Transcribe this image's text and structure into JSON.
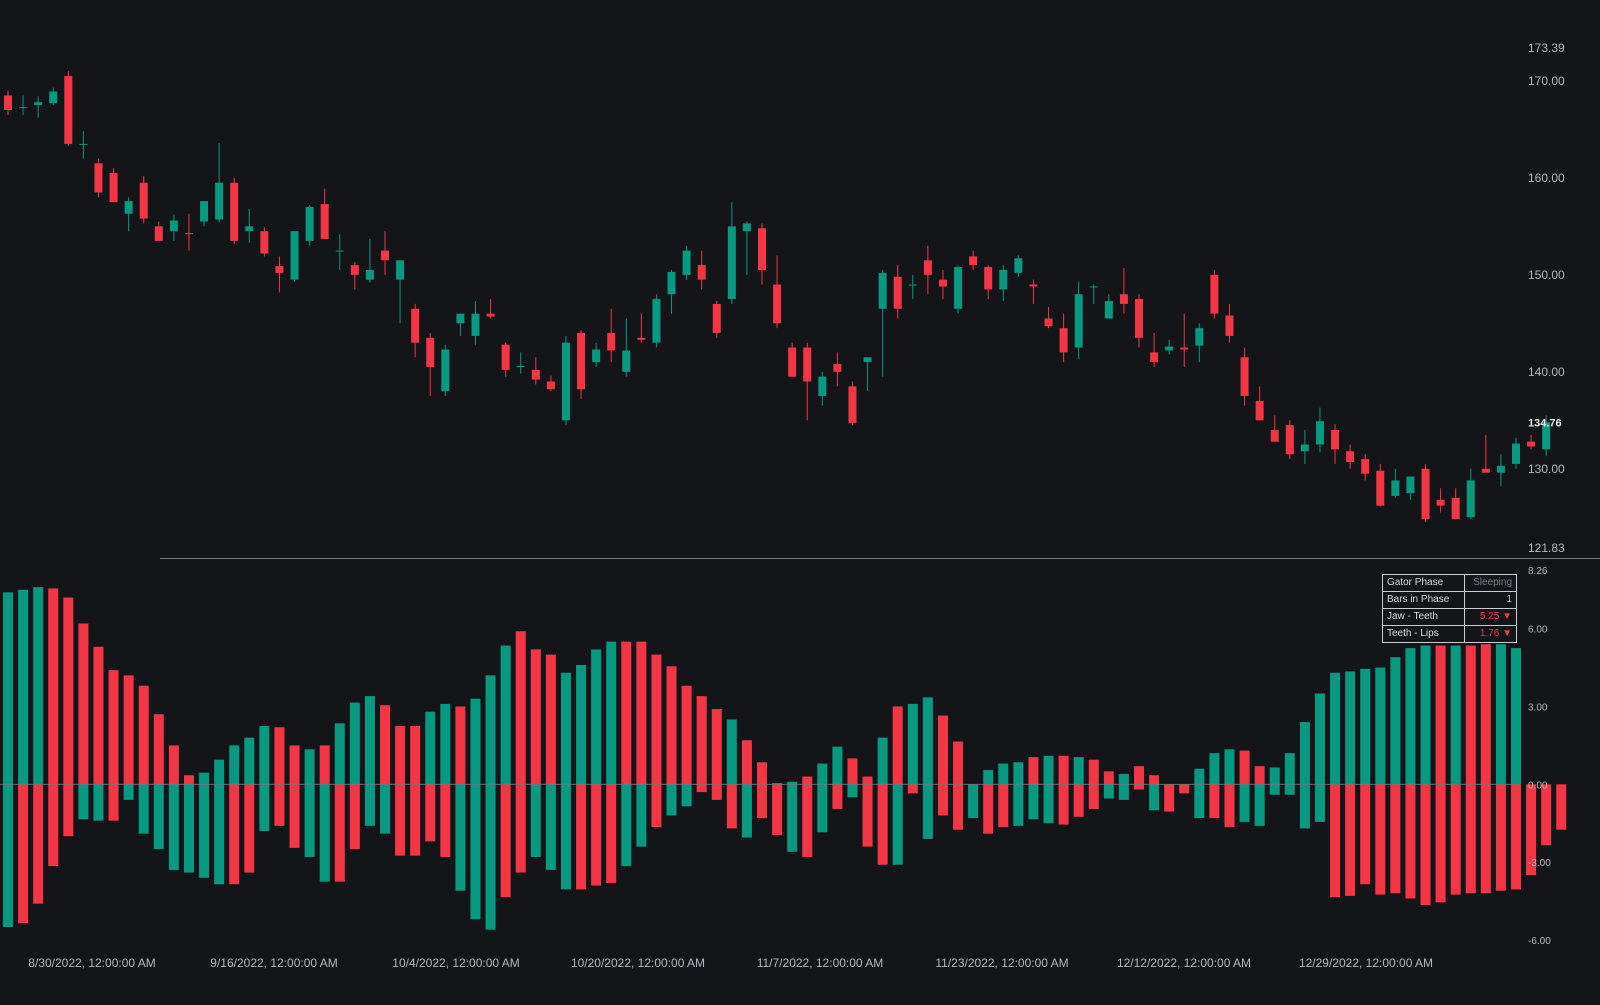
{
  "colors": {
    "background": "#141519",
    "up": "#089981",
    "down": "#f23645",
    "axis_text": "#b2b5be",
    "separator": "#787b86"
  },
  "chart_data": [
    {
      "type": "candlestick",
      "title": "",
      "x_tick_labels": [
        "8/30/2022, 12:00:00 AM",
        "9/16/2022, 12:00:00 AM",
        "10/4/2022, 12:00:00 AM",
        "10/20/2022, 12:00:00 AM",
        "11/7/2022, 12:00:00 AM",
        "11/23/2022, 12:00:00 AM",
        "12/12/2022, 12:00:00 AM",
        "12/29/2022, 12:00:00 AM"
      ],
      "y_ticks": [
        "173.39",
        "170.00",
        "160.00",
        "150.00",
        "140.00",
        "130.00",
        "121.83"
      ],
      "y_range": [
        121.83,
        173.39
      ],
      "last_price": "134.76",
      "grid": false,
      "ohlc": [
        [
          168.5,
          169.0,
          166.5,
          167.0
        ],
        [
          167.2,
          168.5,
          166.5,
          167.3
        ],
        [
          167.5,
          168.4,
          166.2,
          167.8
        ],
        [
          167.7,
          169.3,
          167.5,
          168.9
        ],
        [
          170.5,
          171.0,
          163.3,
          163.5
        ],
        [
          163.4,
          164.8,
          162.0,
          163.5
        ],
        [
          161.5,
          162.0,
          158.0,
          158.5
        ],
        [
          160.5,
          161.0,
          157.5,
          157.5
        ],
        [
          156.3,
          158.0,
          154.5,
          157.6
        ],
        [
          159.5,
          160.2,
          155.3,
          155.8
        ],
        [
          155.0,
          155.5,
          153.5,
          153.5
        ],
        [
          154.5,
          156.2,
          153.5,
          155.6
        ],
        [
          154.3,
          156.3,
          152.5,
          154.2
        ],
        [
          155.5,
          157.6,
          155.0,
          157.6
        ],
        [
          155.7,
          163.6,
          155.4,
          159.5
        ],
        [
          159.5,
          160.0,
          153.2,
          153.5
        ],
        [
          154.5,
          156.8,
          153.3,
          155.0
        ],
        [
          154.5,
          154.9,
          151.9,
          152.2
        ],
        [
          150.9,
          151.9,
          148.2,
          150.2
        ],
        [
          149.5,
          154.5,
          149.3,
          154.5
        ],
        [
          153.5,
          157.2,
          153.0,
          157.0
        ],
        [
          157.3,
          158.9,
          153.7,
          153.7
        ],
        [
          152.5,
          154.2,
          150.5,
          152.5
        ],
        [
          151.0,
          151.3,
          148.5,
          150.0
        ],
        [
          149.5,
          153.7,
          149.2,
          150.5
        ],
        [
          152.5,
          154.5,
          150.0,
          151.5
        ],
        [
          149.5,
          150.5,
          145.0,
          151.5
        ],
        [
          146.5,
          147.0,
          141.5,
          143.0
        ],
        [
          143.5,
          144.0,
          137.5,
          140.5
        ],
        [
          138.0,
          142.8,
          137.5,
          142.3
        ],
        [
          145.0,
          146.0,
          143.7,
          146.0
        ],
        [
          143.7,
          147.3,
          142.8,
          146.0
        ],
        [
          146.0,
          147.5,
          145.5,
          145.7
        ],
        [
          142.8,
          143.0,
          139.5,
          140.2
        ],
        [
          140.6,
          142.0,
          139.8,
          140.6
        ],
        [
          140.2,
          141.5,
          138.7,
          139.2
        ],
        [
          139.0,
          139.6,
          138.0,
          138.2
        ],
        [
          135.0,
          143.7,
          134.5,
          143.0
        ],
        [
          144.0,
          144.3,
          137.2,
          138.2
        ],
        [
          141.0,
          143.0,
          140.5,
          142.3
        ],
        [
          144.0,
          146.5,
          141.0,
          142.2
        ],
        [
          140.0,
          145.5,
          139.5,
          142.2
        ],
        [
          143.5,
          146.0,
          143.0,
          143.3
        ],
        [
          143.0,
          148.0,
          142.5,
          147.5
        ],
        [
          148.0,
          150.5,
          146.0,
          150.3
        ],
        [
          150.0,
          153.0,
          149.5,
          152.5
        ],
        [
          151.0,
          152.5,
          148.5,
          149.5
        ],
        [
          147.0,
          147.3,
          143.5,
          144.0
        ],
        [
          147.5,
          157.5,
          147.0,
          155.0
        ],
        [
          154.5,
          155.5,
          150.0,
          155.3
        ],
        [
          154.8,
          155.3,
          149.0,
          150.5
        ],
        [
          149.0,
          152.0,
          144.5,
          145.0
        ],
        [
          142.5,
          143.0,
          139.5,
          139.5
        ],
        [
          142.5,
          143.0,
          135.0,
          139.0
        ],
        [
          137.5,
          140.0,
          136.5,
          139.5
        ],
        [
          140.8,
          142.0,
          138.5,
          140.0
        ],
        [
          138.5,
          139.0,
          134.5,
          134.7
        ],
        [
          141.0,
          141.4,
          138.0,
          141.5
        ],
        [
          146.5,
          150.5,
          139.5,
          150.2
        ],
        [
          149.8,
          151.0,
          145.5,
          146.5
        ],
        [
          149.0,
          150.0,
          147.5,
          149.0
        ],
        [
          151.5,
          153.0,
          148.0,
          150.0
        ],
        [
          149.5,
          150.5,
          147.5,
          148.8
        ],
        [
          146.5,
          151.0,
          146.0,
          150.8
        ],
        [
          151.9,
          152.5,
          150.5,
          151.0
        ],
        [
          150.8,
          151.0,
          147.5,
          148.5
        ],
        [
          148.5,
          151.0,
          147.3,
          150.5
        ],
        [
          150.2,
          152.0,
          149.8,
          151.7
        ],
        [
          149.0,
          149.5,
          147.0,
          148.8
        ],
        [
          145.5,
          146.7,
          144.5,
          144.7
        ],
        [
          144.5,
          146.0,
          141.0,
          142.0
        ],
        [
          142.5,
          149.3,
          141.3,
          148.0
        ],
        [
          148.8,
          149.0,
          147.0,
          148.8
        ],
        [
          145.5,
          148.0,
          145.5,
          147.3
        ],
        [
          148.0,
          150.7,
          146.0,
          147.0
        ],
        [
          147.5,
          148.0,
          142.5,
          143.5
        ],
        [
          142.0,
          144.0,
          140.5,
          141.0
        ],
        [
          142.2,
          143.3,
          141.8,
          142.6
        ],
        [
          142.5,
          146.0,
          140.5,
          142.3
        ],
        [
          142.7,
          145.0,
          141.0,
          144.5
        ],
        [
          150.0,
          150.5,
          145.5,
          146.0
        ],
        [
          145.8,
          147.0,
          143.0,
          143.7
        ],
        [
          141.5,
          142.5,
          136.5,
          137.5
        ],
        [
          137.0,
          138.5,
          135.0,
          135.0
        ],
        [
          134.0,
          135.5,
          133.3,
          132.8
        ],
        [
          134.5,
          135.0,
          131.0,
          131.5
        ],
        [
          131.8,
          134.0,
          130.5,
          132.5
        ],
        [
          132.5,
          136.3,
          131.7,
          134.9
        ],
        [
          134.0,
          134.6,
          130.5,
          132.0
        ],
        [
          131.8,
          132.5,
          130.0,
          130.7
        ],
        [
          131.0,
          131.5,
          128.8,
          129.5
        ],
        [
          129.8,
          130.5,
          126.1,
          126.2
        ],
        [
          127.2,
          130.0,
          127.0,
          128.8
        ],
        [
          127.5,
          129.2,
          126.8,
          129.2
        ],
        [
          130.0,
          130.5,
          124.5,
          124.8
        ],
        [
          126.8,
          128.0,
          125.5,
          126.2
        ],
        [
          127.0,
          128.0,
          124.8,
          124.8
        ],
        [
          125.0,
          130.0,
          124.8,
          128.8
        ],
        [
          130.0,
          133.5,
          129.8,
          129.6
        ],
        [
          129.6,
          131.5,
          128.2,
          130.3
        ],
        [
          130.5,
          133.2,
          130.0,
          132.6
        ],
        [
          132.8,
          133.5,
          132.0,
          132.3
        ],
        [
          132.0,
          135.5,
          131.3,
          134.8
        ]
      ]
    },
    {
      "type": "bar",
      "title": "",
      "y_ticks": [
        "8.26",
        "6.00",
        "3.00",
        "0.00",
        "-3.00",
        "-6.00"
      ],
      "y_range": [
        -6.0,
        8.26
      ],
      "grid": false,
      "series": [
        {
          "values": [
            7.4,
            7.5,
            7.6,
            7.55,
            7.2,
            6.2,
            5.3,
            4.4,
            4.2,
            3.8,
            2.7,
            1.5,
            0.35,
            0.45,
            0.95,
            1.5,
            1.8,
            2.25,
            2.2,
            1.5,
            1.35,
            1.5,
            2.35,
            3.15,
            3.4,
            3.05,
            2.25,
            2.25,
            2.8,
            3.1,
            3.0,
            3.3,
            4.2,
            5.35,
            5.9,
            5.2,
            5.0,
            4.3,
            4.6,
            5.2,
            5.5,
            5.5,
            5.5,
            5.0,
            4.55,
            3.8,
            3.4,
            2.9,
            2.5,
            1.7,
            0.85,
            0.05,
            0.1,
            0.3,
            0.8,
            1.45,
            1.0,
            0.3,
            1.8,
            3.0,
            3.1,
            3.35,
            2.65,
            1.65,
            0.0,
            0.55,
            0.8,
            0.85,
            1.05,
            1.1,
            1.1,
            1.05,
            0.95,
            0.5,
            0.4,
            0.7,
            0.35,
            -0.15,
            0.0,
            0.6,
            1.2,
            1.35,
            1.3,
            0.7,
            0.65,
            1.2,
            2.4,
            3.5,
            4.3,
            4.35,
            4.45,
            4.5,
            4.9,
            5.25,
            5.35,
            5.35,
            5.35,
            5.35,
            5.4,
            5.4,
            5.25
          ],
          "colors": [
            "up",
            "up",
            "up",
            "down",
            "down",
            "down",
            "down",
            "down",
            "down",
            "down",
            "down",
            "down",
            "down",
            "up",
            "up",
            "up",
            "up",
            "up",
            "down",
            "down",
            "up",
            "down",
            "up",
            "up",
            "up",
            "down",
            "down",
            "down",
            "up",
            "up",
            "down",
            "up",
            "up",
            "up",
            "down",
            "down",
            "down",
            "up",
            "up",
            "up",
            "up",
            "down",
            "down",
            "down",
            "down",
            "down",
            "down",
            "down",
            "up",
            "down",
            "down",
            "up",
            "up",
            "down",
            "up",
            "up",
            "down",
            "down",
            "up",
            "down",
            "up",
            "up",
            "down",
            "down",
            "down",
            "up",
            "up",
            "up",
            "down",
            "up",
            "down",
            "up",
            "down",
            "down",
            "up",
            "down",
            "down",
            "up",
            "down",
            "up",
            "up",
            "up",
            "down",
            "down",
            "up",
            "up",
            "up",
            "up",
            "up",
            "up",
            "up",
            "up",
            "up",
            "up",
            "up",
            "down",
            "up",
            "down",
            "down",
            "up",
            "up",
            "down"
          ]
        },
        {
          "values": [
            -5.5,
            -5.35,
            -4.6,
            -3.15,
            -2.0,
            -1.35,
            -1.4,
            -1.4,
            -0.6,
            -1.9,
            -2.5,
            -3.3,
            -3.4,
            -3.6,
            -3.85,
            -3.85,
            -3.4,
            -1.8,
            -1.6,
            -2.45,
            -2.8,
            -3.75,
            -3.75,
            -2.5,
            -1.6,
            -1.9,
            -2.75,
            -2.75,
            -2.2,
            -2.8,
            -4.1,
            -5.2,
            -5.6,
            -4.35,
            -3.4,
            -2.8,
            -3.3,
            -4.05,
            -4.05,
            -3.9,
            -3.8,
            -3.15,
            -2.4,
            -1.65,
            -1.2,
            -0.85,
            -0.3,
            -0.6,
            -1.7,
            -2.05,
            -1.3,
            -1.95,
            -2.6,
            -2.8,
            -1.85,
            -0.95,
            -0.5,
            -2.4,
            -3.1,
            -3.1,
            -0.35,
            -2.1,
            -1.2,
            -1.75,
            -1.3,
            -1.9,
            -1.65,
            -1.6,
            -1.35,
            -1.5,
            -1.55,
            -1.25,
            -0.95,
            -0.55,
            -0.6,
            -0.2,
            -1.0,
            -1.05,
            -0.35,
            -1.3,
            -1.3,
            -1.65,
            -1.45,
            -1.6,
            -0.4,
            -0.4,
            -1.7,
            -1.45,
            -4.35,
            -4.3,
            -3.85,
            -4.25,
            -4.2,
            -4.4,
            -4.65,
            -4.55,
            -4.25,
            -4.2,
            -4.2,
            -4.1,
            -4.05,
            -3.5,
            -2.35,
            -1.75
          ],
          "colors": [
            "up",
            "down",
            "down",
            "down",
            "down",
            "up",
            "up",
            "down",
            "up",
            "up",
            "up",
            "up",
            "up",
            "up",
            "up",
            "down",
            "down",
            "up",
            "down",
            "down",
            "up",
            "up",
            "down",
            "down",
            "up",
            "up",
            "down",
            "down",
            "down",
            "down",
            "up",
            "up",
            "up",
            "down",
            "down",
            "up",
            "up",
            "up",
            "down",
            "down",
            "down",
            "up",
            "up",
            "down",
            "up",
            "up",
            "down",
            "down",
            "down",
            "up",
            "down",
            "down",
            "up",
            "down",
            "up",
            "down",
            "up",
            "down",
            "down",
            "up",
            "down",
            "up",
            "down",
            "down",
            "up",
            "down",
            "down",
            "up",
            "up",
            "up",
            "down",
            "down",
            "down",
            "up",
            "up",
            "down",
            "up",
            "down",
            "down",
            "up",
            "down",
            "down",
            "up",
            "up",
            "up",
            "up",
            "up",
            "up",
            "down",
            "down",
            "down",
            "down",
            "down",
            "down",
            "down",
            "down",
            "down",
            "down",
            "down",
            "down",
            "down",
            "down",
            "down",
            "down",
            "down"
          ]
        }
      ]
    }
  ],
  "status_table": {
    "rows": [
      {
        "label": "Gator Phase",
        "value": "Sleeping",
        "value_color": "#787b86"
      },
      {
        "label": "Bars in Phase",
        "value": "1",
        "value_color": "#b2b5be"
      },
      {
        "label": "Jaw - Teeth",
        "value": "5.25 ▼",
        "value_color": "#f23645"
      },
      {
        "label": "Teeth - Lips",
        "value": "1.76 ▼",
        "value_color": "#f23645"
      }
    ]
  }
}
